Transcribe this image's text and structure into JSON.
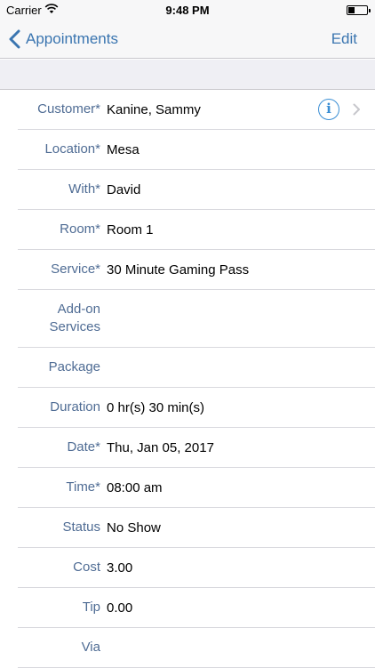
{
  "status_bar": {
    "carrier": "Carrier",
    "time": "9:48 PM",
    "wifi_icon": "wifi-icon",
    "battery_icon": "battery-icon"
  },
  "nav": {
    "back_label": "Appointments",
    "edit_label": "Edit",
    "accent_color": "#3a75b0"
  },
  "fields": [
    {
      "label": "Customer*",
      "value": "Kanine, Sammy"
    },
    {
      "label": "Location*",
      "value": "Mesa"
    },
    {
      "label": "With*",
      "value": "David"
    },
    {
      "label": "Room*",
      "value": "Room 1"
    },
    {
      "label": "Service*",
      "value": "30 Minute Gaming Pass"
    },
    {
      "label": "Add-on Services",
      "value": ""
    },
    {
      "label": "Package",
      "value": ""
    },
    {
      "label": "Duration",
      "value": "0 hr(s) 30 min(s)"
    },
    {
      "label": "Date*",
      "value": "Thu, Jan 05, 2017"
    },
    {
      "label": "Time*",
      "value": "08:00 am"
    },
    {
      "label": "Status",
      "value": "No Show"
    },
    {
      "label": "Cost",
      "value": "3.00"
    },
    {
      "label": "Tip",
      "value": "0.00"
    },
    {
      "label": "Via",
      "value": ""
    }
  ],
  "colors": {
    "label": "#4f6c94",
    "info": "#3a8ed4"
  }
}
